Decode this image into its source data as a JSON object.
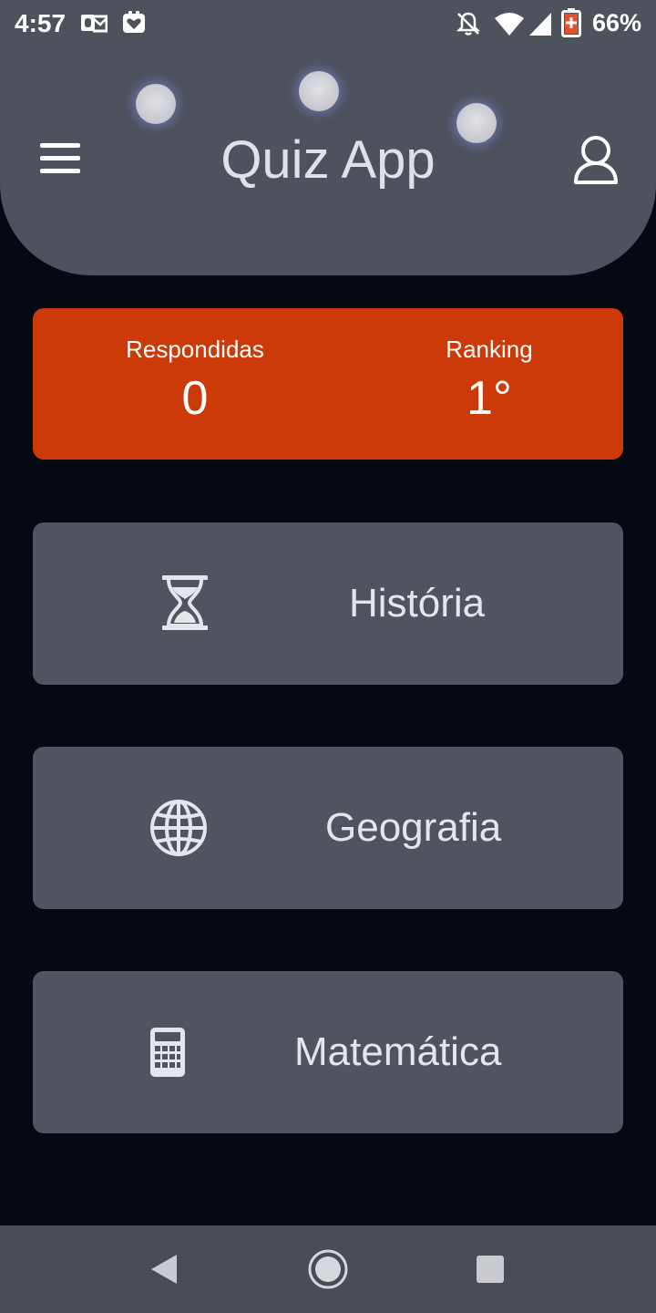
{
  "status_bar": {
    "time": "4:57",
    "battery_percent": "66%"
  },
  "header": {
    "title": "Quiz App",
    "menu_icon": "hamburger-menu-icon",
    "profile_icon": "user-icon",
    "background_color": "#4e525c"
  },
  "stats": {
    "answered_label": "Respondidas",
    "answered_value": "0",
    "ranking_label": "Ranking",
    "ranking_value": "1°",
    "background_color": "#cc3a0a"
  },
  "categories": [
    {
      "label": "História",
      "icon": "hourglass-icon"
    },
    {
      "label": "Geografia",
      "icon": "globe-icon"
    },
    {
      "label": "Matemática",
      "icon": "calculator-icon"
    }
  ],
  "colors": {
    "page_background": "#060812",
    "card_background": "#50545e",
    "nav_background": "#494c54"
  }
}
